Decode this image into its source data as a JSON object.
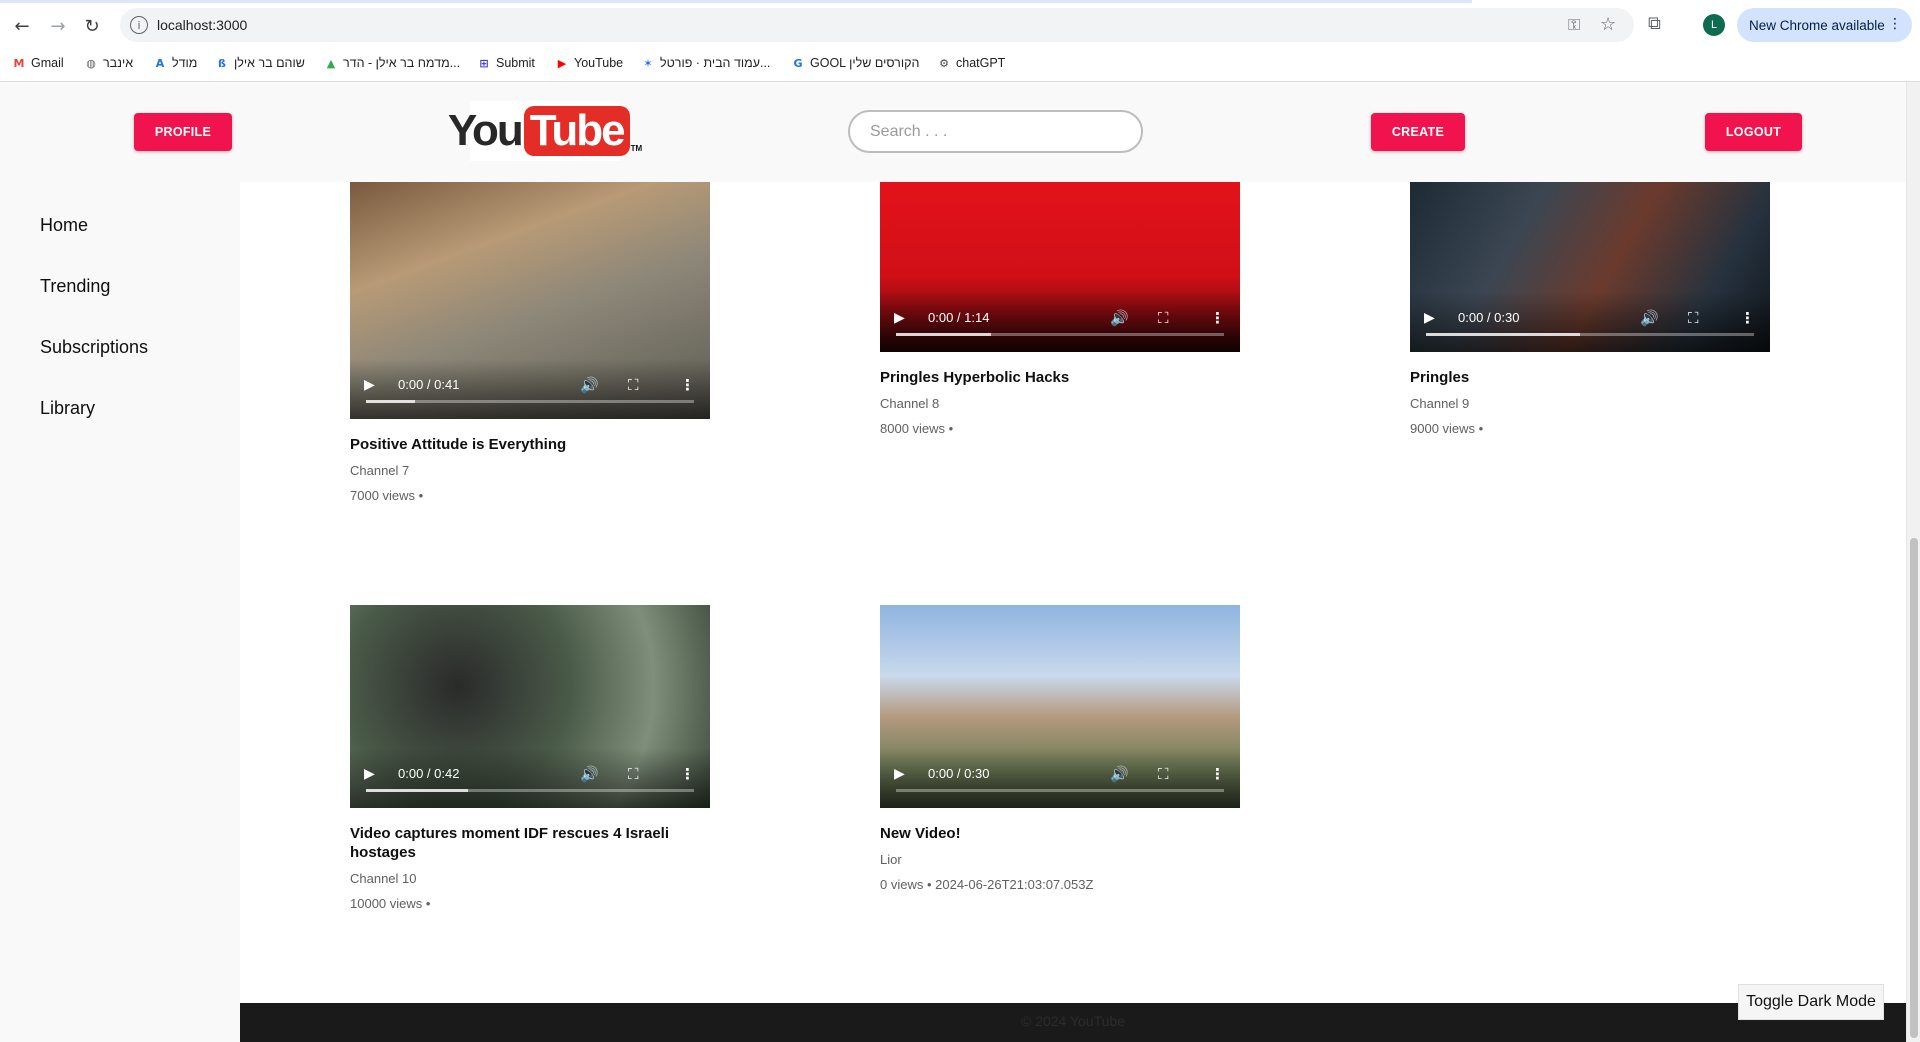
{
  "browser": {
    "url": "localhost:3000",
    "new_chrome": "New Chrome available",
    "avatar_letter": "L",
    "bookmarks": [
      {
        "label": "Gmail",
        "icon": "gmail-icon",
        "color": "#ea4335",
        "glyph": "M"
      },
      {
        "label": "אינבר",
        "icon": "globe-icon",
        "color": "#5f6368",
        "glyph": "◍"
      },
      {
        "label": "מודל",
        "icon": "moodle-icon",
        "color": "#1a73e8",
        "glyph": "A"
      },
      {
        "label": "שוהם בר אילן",
        "icon": "figure-icon",
        "color": "#1a73e8",
        "glyph": "ß"
      },
      {
        "label": "מדמח בר אילן - הדר...",
        "icon": "drive-icon",
        "color": "#34a853",
        "glyph": "▲"
      },
      {
        "label": "Submit",
        "icon": "submit-icon",
        "color": "#3c3cd6",
        "glyph": "⊞"
      },
      {
        "label": "YouTube",
        "icon": "youtube-icon",
        "color": "#ff0000",
        "glyph": "▶"
      },
      {
        "label": "עמוד הבית · פורטל...",
        "icon": "portal-icon",
        "color": "#1a73e8",
        "glyph": "✶"
      },
      {
        "label": "GOOL הקורסים שלין",
        "icon": "gool-icon",
        "color": "#1a73e8",
        "glyph": "G"
      },
      {
        "label": "chatGPT",
        "icon": "chatgpt-icon",
        "color": "#444444",
        "glyph": "⚙"
      }
    ]
  },
  "header": {
    "profile": "PROFILE",
    "create": "CREATE",
    "logout": "LOGOUT",
    "search_placeholder": "Search . . ."
  },
  "sidebar": {
    "items": [
      "Home",
      "Trending",
      "Subscriptions",
      "Library"
    ]
  },
  "videos": [
    {
      "title": "Positive Attitude is Everything",
      "channel": "Channel 7",
      "meta": "7000 views •",
      "time": "0:00 / 0:41",
      "buffered": 0.15
    },
    {
      "title": "Pringles Hyperbolic Hacks",
      "channel": "Channel 8",
      "meta": "8000 views •",
      "time": "0:00 / 1:14",
      "buffered": 0.29
    },
    {
      "title": "Pringles",
      "channel": "Channel 9",
      "meta": "9000 views •",
      "time": "0:00 / 0:30",
      "buffered": 0.47
    },
    {
      "title": "Video captures moment IDF rescues 4 Israeli hostages",
      "channel": "Channel 10",
      "meta": "10000 views •",
      "time": "0:00 / 0:42",
      "buffered": 0.31
    },
    {
      "title": "New Video!",
      "channel": "Lior",
      "meta": "0 views • 2024-06-26T21:03:07.053Z",
      "time": "0:00 / 0:30",
      "buffered": 0.0
    }
  ],
  "footer": {
    "copyright": "© 2024 YouTube",
    "toggle": "Toggle Dark Mode"
  }
}
